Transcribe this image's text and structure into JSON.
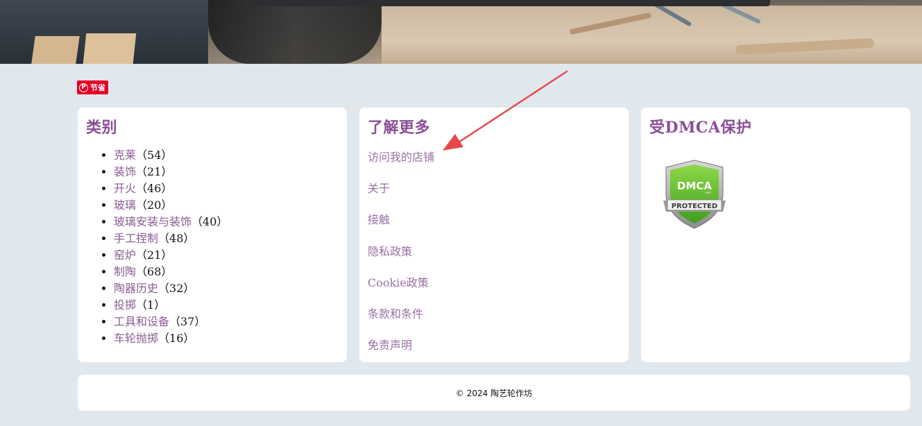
{
  "pinterest": {
    "label": "节省",
    "icon": "pinterest-icon"
  },
  "categories": {
    "title": "类别",
    "items": [
      {
        "label": "克莱",
        "count": "（54）"
      },
      {
        "label": "装饰",
        "count": "（21）"
      },
      {
        "label": "开火",
        "count": "（46）"
      },
      {
        "label": "玻璃",
        "count": "（20）"
      },
      {
        "label": "玻璃安装与装饰",
        "count": "（40）"
      },
      {
        "label": "手工捏制",
        "count": "（48）"
      },
      {
        "label": "窑炉",
        "count": "（21）"
      },
      {
        "label": "制陶",
        "count": "（68）"
      },
      {
        "label": "陶器历史",
        "count": "（32）"
      },
      {
        "label": "投掷",
        "count": "（1）"
      },
      {
        "label": "工具和设备",
        "count": "（37）"
      },
      {
        "label": "车轮抛掷",
        "count": "（16）"
      }
    ]
  },
  "learn_more": {
    "title": "了解更多",
    "links": [
      "访问我的店铺",
      "关于",
      "接触",
      "隐私政策",
      "Cookie政策",
      "条款和条件",
      "免责声明"
    ]
  },
  "dmca": {
    "title": "受DMCA保护",
    "badge_logo": "DMCA",
    "badge_text": "PROTECTED",
    "badge_small": ".com"
  },
  "footer": {
    "text": "© 2024  陶艺轮作坊"
  },
  "colors": {
    "accent": "#8a4f97",
    "link": "#9a6fa3",
    "pinterest": "#e60023",
    "arrow": "#e8484a"
  }
}
